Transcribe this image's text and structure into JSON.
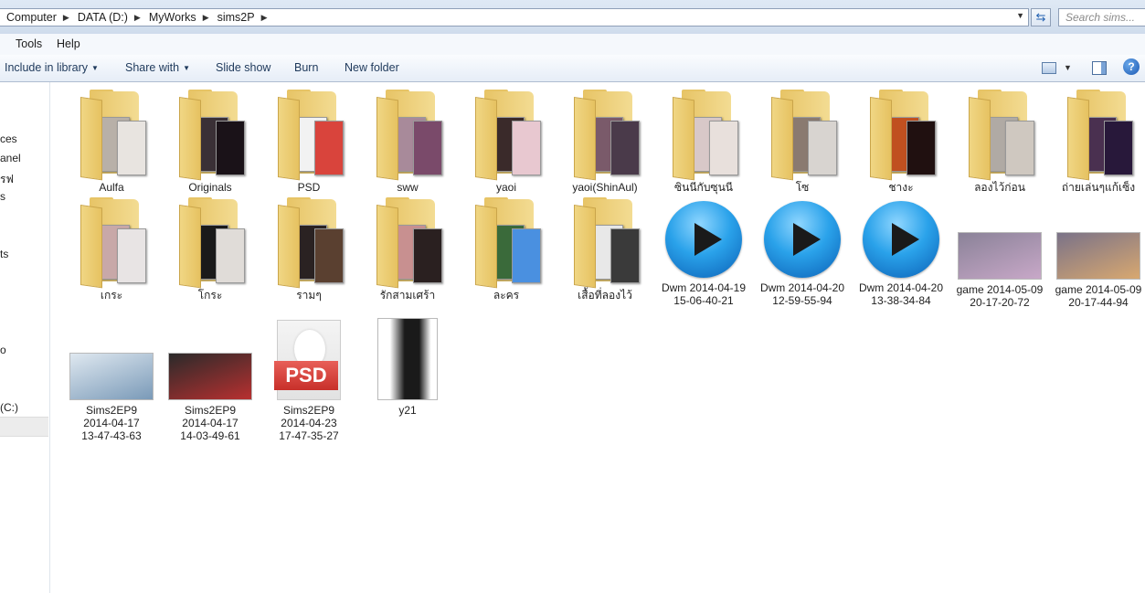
{
  "address": {
    "crumbs": [
      "Computer",
      "DATA (D:)",
      "MyWorks",
      "sims2P"
    ],
    "search_placeholder": "Search sims..."
  },
  "menu": {
    "tools": "Tools",
    "help": "Help"
  },
  "commands": {
    "include": "Include in library",
    "share": "Share with",
    "slideshow": "Slide show",
    "burn": "Burn",
    "newfolder": "New folder"
  },
  "nav": {
    "fragments": [
      "ces",
      "anel",
      "รฟ",
      "s",
      "ts",
      "o",
      "(C:)"
    ]
  },
  "items": [
    {
      "label": "Aulfa",
      "type": "folder",
      "colors": [
        "#b8b0a8",
        "#e8e4e0"
      ]
    },
    {
      "label": "Originals",
      "type": "folder",
      "colors": [
        "#3a3036",
        "#1a1218"
      ]
    },
    {
      "label": "PSD",
      "type": "folder",
      "colors": [
        "#f2f2f2",
        "#d9443c"
      ]
    },
    {
      "label": "sww",
      "type": "folder",
      "colors": [
        "#a88a9a",
        "#7a4a6a"
      ]
    },
    {
      "label": "yaoi",
      "type": "folder",
      "colors": [
        "#3a2a2a",
        "#e8c8d0"
      ]
    },
    {
      "label": "yaoi(ShinAul)",
      "type": "folder",
      "colors": [
        "#7a5a6a",
        "#4a3a4a"
      ]
    },
    {
      "label": "ซินนีกับซุนนี",
      "type": "folder",
      "colors": [
        "#d8c8c8",
        "#e8e0dc"
      ]
    },
    {
      "label": "โซ",
      "type": "folder",
      "colors": [
        "#8a7a70",
        "#d8d4d0"
      ]
    },
    {
      "label": "ชางะ",
      "type": "folder",
      "colors": [
        "#c05020",
        "#201010"
      ]
    },
    {
      "label": "ลองไว้ก่อน",
      "type": "folder",
      "colors": [
        "#b0aaa4",
        "#cfc8c0"
      ]
    },
    {
      "label": "ถ่ายเล่นๆแก้เซ็ง",
      "type": "folder",
      "colors": [
        "#4a3050",
        "#28183a"
      ]
    },
    {
      "label": "เกระ",
      "type": "folder",
      "colors": [
        "#c8a8a8",
        "#e8e4e4"
      ]
    },
    {
      "label": "โกระ",
      "type": "folder",
      "colors": [
        "#1a1a1a",
        "#e0dcd8"
      ]
    },
    {
      "label": "รามๆ",
      "type": "folder",
      "colors": [
        "#2a2222",
        "#5a4030"
      ]
    },
    {
      "label": "รักสามเศร้า",
      "type": "folder",
      "colors": [
        "#c89090",
        "#2a2020"
      ]
    },
    {
      "label": "ละคร",
      "type": "folder",
      "colors": [
        "#3a6a3a",
        "#4a90e0"
      ]
    },
    {
      "label": "เสื้อที่ลองไว้",
      "type": "folder",
      "colors": [
        "#e8e8e8",
        "#3a3a3a"
      ]
    },
    {
      "label": "Dwm 2014-04-19\n15-06-40-21",
      "type": "video"
    },
    {
      "label": "Dwm 2014-04-20\n12-59-55-94",
      "type": "video"
    },
    {
      "label": "Dwm 2014-04-20\n13-38-34-84",
      "type": "video"
    },
    {
      "label": "game 2014-05-09\n20-17-20-72",
      "type": "photo",
      "colors": [
        "#8a8298",
        "#c8a8c8"
      ]
    },
    {
      "label": "game 2014-05-09\n20-17-44-94",
      "type": "photo",
      "colors": [
        "#7a7288",
        "#d8a870"
      ]
    },
    {
      "label": "Sims2EP9\n2014-04-17\n13-47-43-63",
      "type": "photo",
      "colors": [
        "#dfe8f0",
        "#7a9ab8"
      ]
    },
    {
      "label": "Sims2EP9\n2014-04-17\n14-03-49-61",
      "type": "photo",
      "colors": [
        "#2a2a2a",
        "#b83030"
      ]
    },
    {
      "label": "Sims2EP9\n2014-04-23\n17-47-35-27",
      "type": "psd",
      "tag": "PSD"
    },
    {
      "label": "y21",
      "type": "portrait",
      "colors": [
        "#ffffff",
        "#1a1a1a"
      ]
    }
  ]
}
